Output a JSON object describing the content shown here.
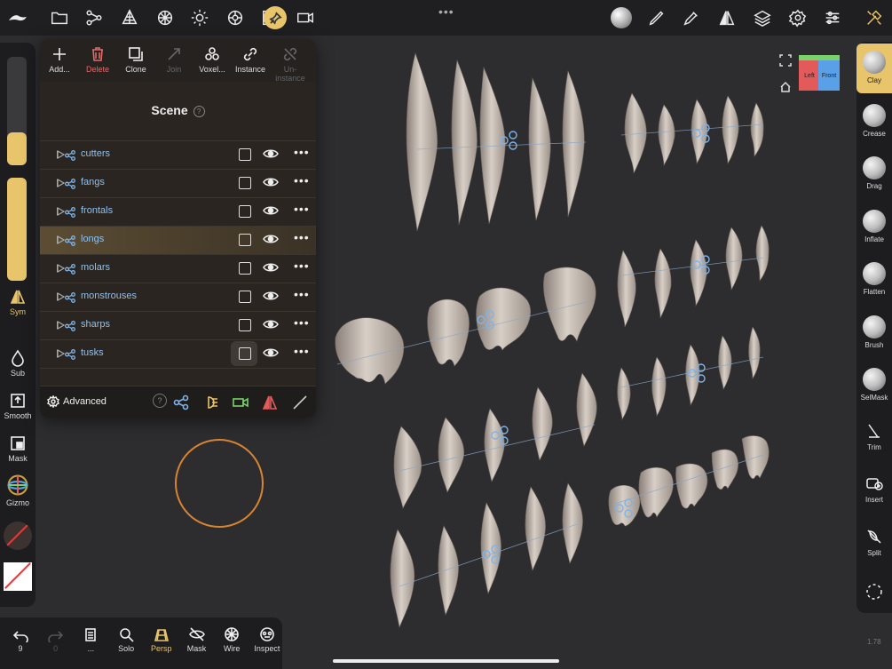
{
  "topbar": {
    "icons": [
      "nomad-logo-icon",
      "folder-icon",
      "scene-tree-icon",
      "topology-icon",
      "material-icon",
      "light-icon",
      "shading-icon",
      "background-icon",
      "camera-icon",
      "matcap-icon",
      "brush-pen-icon",
      "eyedropper-icon",
      "symmetry-icon",
      "layers-icon",
      "settings-icon",
      "sliders-icon",
      "tools-icon"
    ]
  },
  "left": {
    "sym_label": "Sym",
    "tools": [
      {
        "label": "Sub",
        "icon": "drop-icon"
      },
      {
        "label": "Smooth",
        "icon": "smooth-icon"
      },
      {
        "label": "Mask",
        "icon": "mask-icon"
      },
      {
        "label": "Gizmo",
        "icon": "gizmo-icon"
      }
    ],
    "size_level": 0.3,
    "intensity_level": 1.0
  },
  "panel": {
    "tools": [
      {
        "label": "Add...",
        "icon": "plus-icon",
        "state": "normal"
      },
      {
        "label": "Delete",
        "icon": "trash-icon",
        "state": "red"
      },
      {
        "label": "Clone",
        "icon": "clone-icon",
        "state": "normal"
      },
      {
        "label": "Join",
        "icon": "join-icon",
        "state": "dim"
      },
      {
        "label": "Voxel...",
        "icon": "voxel-icon",
        "state": "normal"
      },
      {
        "label": "Instance",
        "icon": "link-icon",
        "state": "normal"
      },
      {
        "label": "Un-instance",
        "icon": "unlink-icon",
        "state": "dim"
      }
    ],
    "title": "Scene",
    "help": "?",
    "rows": [
      {
        "name": "cutters",
        "selected": false
      },
      {
        "name": "fangs",
        "selected": false
      },
      {
        "name": "frontals",
        "selected": false
      },
      {
        "name": "longs",
        "selected": true
      },
      {
        "name": "molars",
        "selected": false
      },
      {
        "name": "monstrouses",
        "selected": false
      },
      {
        "name": "sharps",
        "selected": false
      },
      {
        "name": "tusks",
        "selected": false
      }
    ],
    "more": "•••",
    "advanced_label": "Advanced"
  },
  "viewcube": {
    "left": "Left",
    "front": "Front"
  },
  "right": {
    "tools": [
      {
        "label": "Clay",
        "type": "ball",
        "active": true
      },
      {
        "label": "Crease",
        "type": "ball",
        "active": false
      },
      {
        "label": "Drag",
        "type": "ball",
        "active": false
      },
      {
        "label": "Inflate",
        "type": "ball",
        "active": false
      },
      {
        "label": "Flatten",
        "type": "ball",
        "active": false
      },
      {
        "label": "Brush",
        "type": "ball",
        "active": false
      },
      {
        "label": "SelMask",
        "type": "ball",
        "active": false
      },
      {
        "label": "Trim",
        "type": "icon",
        "active": false
      },
      {
        "label": "Insert",
        "type": "icon",
        "active": false
      },
      {
        "label": "Split",
        "type": "icon",
        "active": false
      }
    ],
    "version": "1.78"
  },
  "bottom": {
    "tools": [
      {
        "label": "9",
        "icon": "undo-icon",
        "state": "normal"
      },
      {
        "label": "0",
        "icon": "redo-icon",
        "state": "dim"
      },
      {
        "label": "...",
        "icon": "history-icon",
        "state": "normal"
      },
      {
        "label": "Solo",
        "icon": "solo-icon",
        "state": "normal"
      },
      {
        "label": "Persp",
        "icon": "persp-icon",
        "state": "gold"
      },
      {
        "label": "Mask",
        "icon": "mask-hide-icon",
        "state": "normal"
      },
      {
        "label": "Wire",
        "icon": "wire-icon",
        "state": "normal"
      },
      {
        "label": "Inspect",
        "icon": "inspect-icon",
        "state": "normal"
      }
    ]
  },
  "colors": {
    "accent": "#e8c46a",
    "brush_ring": "#d88432",
    "link_blue": "#8fc0ee"
  }
}
